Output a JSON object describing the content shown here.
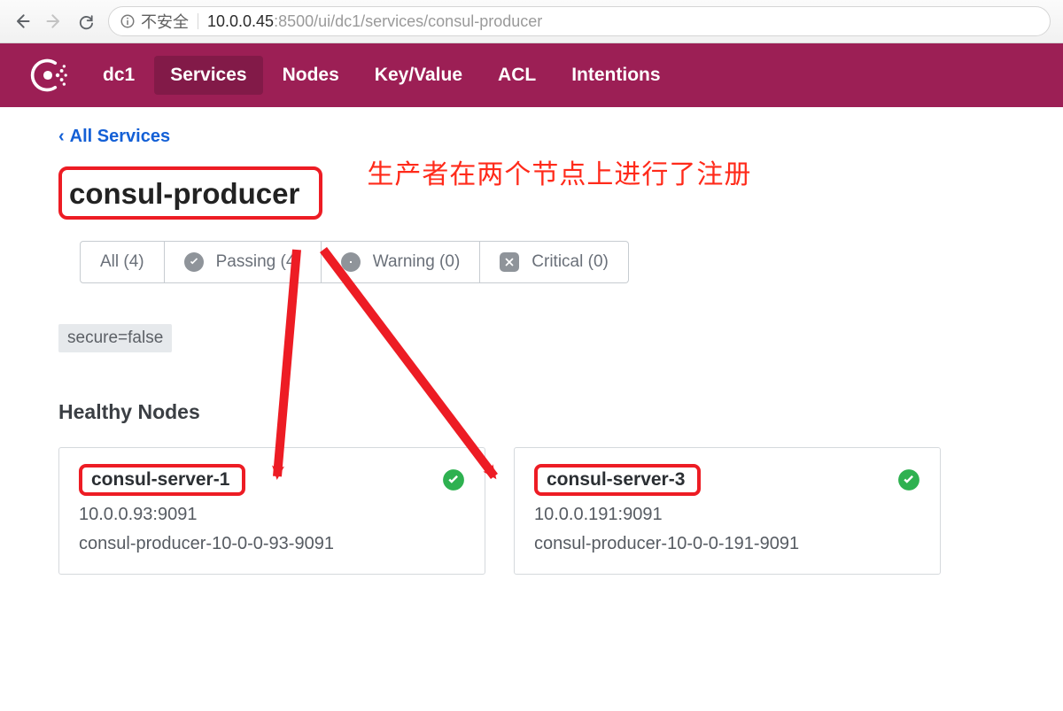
{
  "browser": {
    "insecure_label": "不安全",
    "url_gray_prefix": "10.0.0.45",
    "url_port": ":8500",
    "url_path": "/ui/dc1/services/consul-producer"
  },
  "header": {
    "datacenter": "dc1",
    "nav": {
      "services": "Services",
      "nodes": "Nodes",
      "kv": "Key/Value",
      "acl": "ACL",
      "intentions": "Intentions"
    }
  },
  "breadcrumb": {
    "back_label": "All Services"
  },
  "service": {
    "name": "consul-producer",
    "tag": "secure=false"
  },
  "annotation_text": "生产者在两个节点上进行了注册",
  "filters": {
    "all": "All (4)",
    "passing": "Passing (4)",
    "warning": "Warning (0)",
    "critical": "Critical (0)"
  },
  "section_title": "Healthy Nodes",
  "nodes": [
    {
      "name": "consul-server-1",
      "address": "10.0.0.93:9091",
      "service_id": "consul-producer-10-0-0-93-9091"
    },
    {
      "name": "consul-server-3",
      "address": "10.0.0.191:9091",
      "service_id": "consul-producer-10-0-0-191-9091"
    }
  ],
  "colors": {
    "brand": "#9c1f55",
    "annotation_red": "#ed1c24",
    "ok_green": "#28a745"
  }
}
